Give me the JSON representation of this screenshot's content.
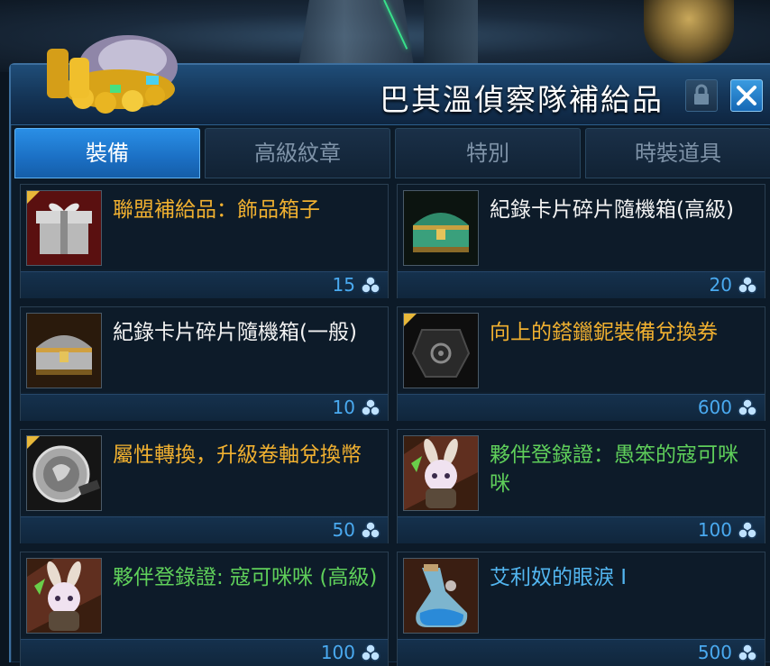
{
  "window": {
    "title": "巴其溫偵察隊補給品"
  },
  "tabs": [
    {
      "label": "裝備",
      "active": true
    },
    {
      "label": "高級紋章",
      "active": false
    },
    {
      "label": "特別",
      "active": false
    },
    {
      "label": "時裝道具",
      "active": false
    }
  ],
  "items": [
    {
      "name": "聯盟補給品：飾品箱子",
      "price": "15",
      "quality": "gold",
      "icon": "silver-gift-box-icon"
    },
    {
      "name": "紀錄卡片碎片隨機箱(高級)",
      "price": "20",
      "quality": "white",
      "icon": "jade-treasure-chest-icon"
    },
    {
      "name": "紀錄卡片碎片隨機箱(一般)",
      "price": "10",
      "quality": "white",
      "icon": "silver-treasure-chest-icon"
    },
    {
      "name": "向上的鎝鑞鈮裝備兌換券",
      "price": "600",
      "quality": "gold",
      "icon": "dark-stone-coupon-icon"
    },
    {
      "name": "屬性轉換，升級卷軸兌換幣",
      "price": "50",
      "quality": "gold",
      "icon": "silver-coin-icon"
    },
    {
      "name": "夥伴登錄證：愚笨的寇可咪咪",
      "price": "100",
      "quality": "green",
      "icon": "bunny-companion-icon"
    },
    {
      "name": "夥伴登錄證: 寇可咪咪 (高級)",
      "price": "100",
      "quality": "green",
      "icon": "bunny-companion-icon"
    },
    {
      "name": "艾利奴的眼淚 Ⅰ",
      "price": "500",
      "quality": "blue",
      "icon": "tear-potion-icon"
    }
  ],
  "colors": {
    "gold": "#f0b030",
    "white": "#f2f2f2",
    "green": "#5fcf5a",
    "blue": "#52b6f0",
    "price": "#4aaaf0",
    "accent": "#2a8fe6"
  },
  "icons": {
    "currency": "triple-coin-currency-icon",
    "lock": "lock-icon",
    "close": "close-icon",
    "header_art": "gold-coin-bag-icon"
  }
}
